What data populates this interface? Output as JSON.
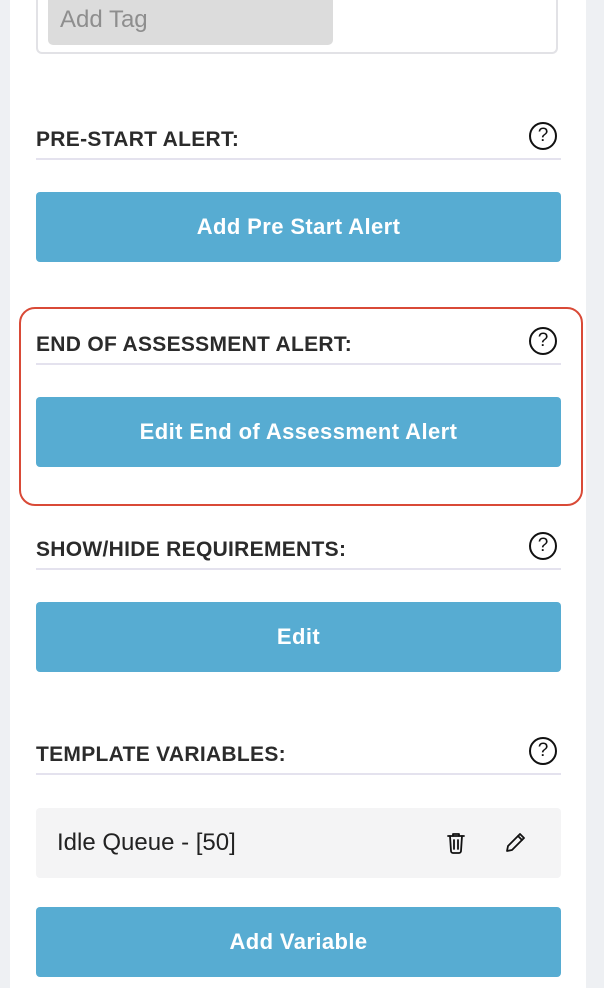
{
  "tags": {
    "input_placeholder": "Add Tag"
  },
  "pre_start": {
    "title": "PRE-START ALERT:",
    "help": "?",
    "button": "Add Pre Start Alert"
  },
  "end_assessment": {
    "title": "END OF ASSESSMENT ALERT:",
    "help": "?",
    "button": "Edit End of Assessment Alert",
    "highlight_color": "#d94a37"
  },
  "requirements": {
    "title": "SHOW/HIDE REQUIREMENTS:",
    "help": "?",
    "button": "Edit"
  },
  "template_variables": {
    "title": "TEMPLATE VARIABLES:",
    "help": "?",
    "items": [
      {
        "name": "Idle Queue - [50]",
        "actions": [
          "trash-icon",
          "pencil-icon"
        ]
      }
    ],
    "button": "Add Variable"
  },
  "colors": {
    "button_bg": "#57acd2",
    "button_text": "#ffffff",
    "divider": "#e4e2ee"
  }
}
